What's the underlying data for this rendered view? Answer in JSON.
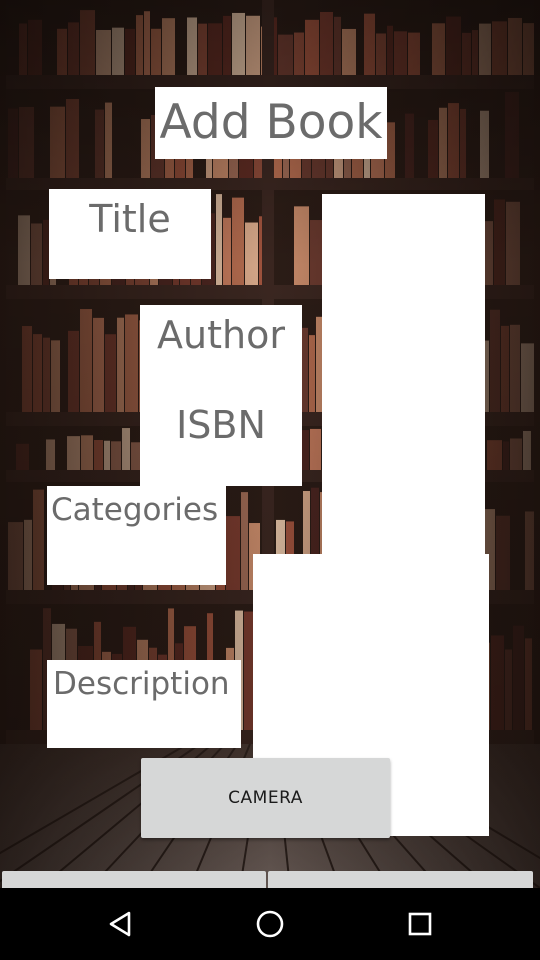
{
  "header": {
    "title": "Add Book"
  },
  "form": {
    "title_label": "Title",
    "author_label": "Author",
    "isbn_label": "ISBN",
    "categories_label": "Categories",
    "description_label": "Description"
  },
  "actions": {
    "camera_label": "CAMERA"
  },
  "navbar": {
    "back_icon": "back-triangle-icon",
    "home_icon": "home-circle-icon",
    "recents_icon": "recents-square-icon"
  },
  "colors": {
    "label_text": "#6b6b6b",
    "button_bg": "#d6d7d7",
    "panel_bg": "#ffffff",
    "navbar_bg": "#000000"
  }
}
